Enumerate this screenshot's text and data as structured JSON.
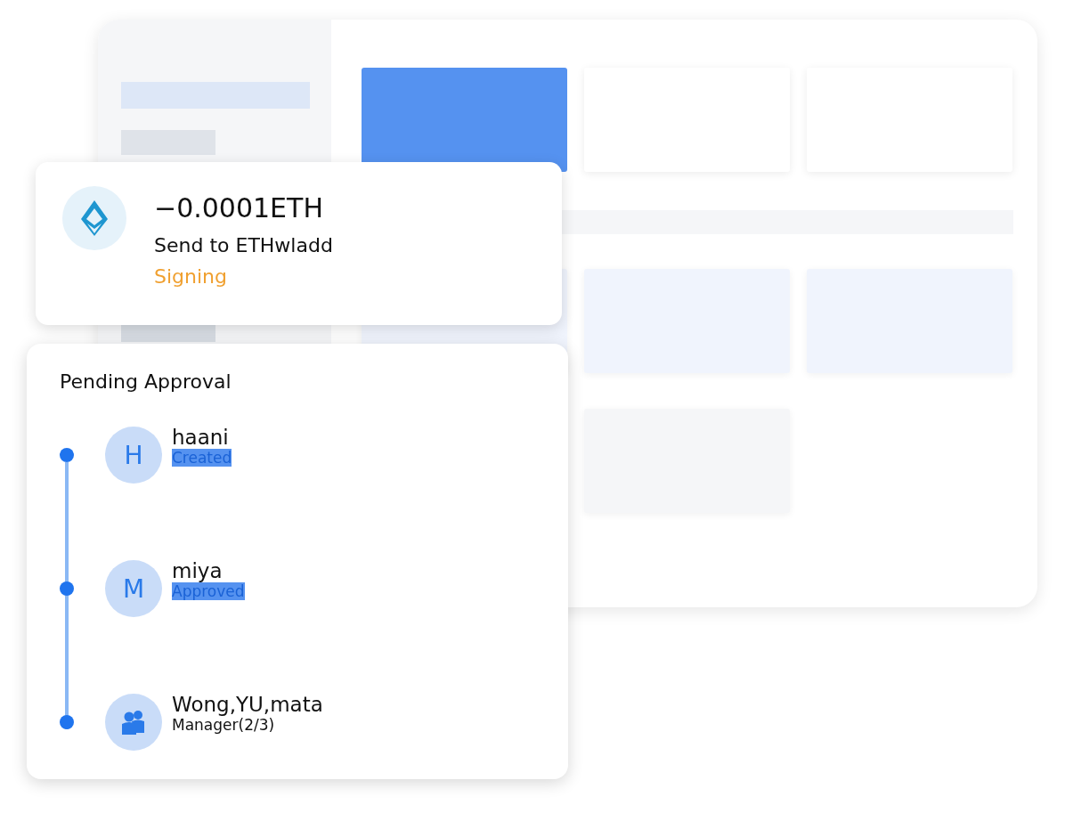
{
  "transaction": {
    "amount": "−0.0001ETH",
    "recipient": "Send to ETHwladd",
    "status": "Signing"
  },
  "approval": {
    "title": "Pending Approval",
    "approvers": [
      {
        "kind": "user",
        "initial": "H",
        "name": "haani",
        "status": "Created"
      },
      {
        "kind": "user",
        "initial": "M",
        "name": "miya",
        "status": "Approved"
      },
      {
        "kind": "group",
        "name": "Wong,YU,mata",
        "status": "Manager(2/3)"
      }
    ]
  }
}
